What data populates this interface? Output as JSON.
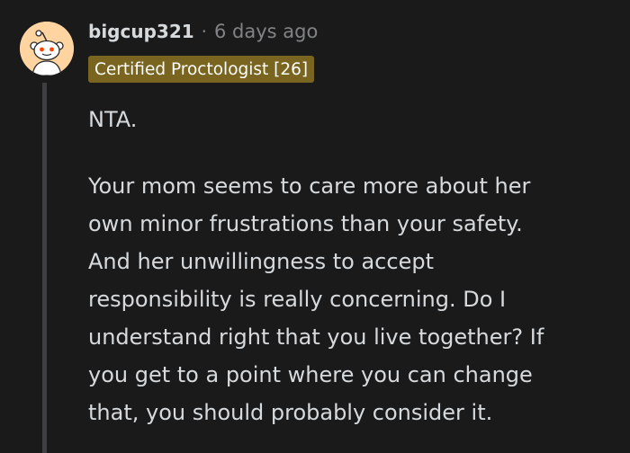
{
  "comment": {
    "username": "bigcup321",
    "separator": "·",
    "timestamp": "6 days ago",
    "flair": "Certified Proctologist [26]",
    "avatar_icon": "reddit-snoo-avatar-icon",
    "paragraphs": [
      [
        "NTA."
      ],
      [
        "Your mom seems to care more about her",
        "own minor frustrations than your safety.",
        "And her unwillingness to accept",
        "responsibility is really concerning. Do I",
        "understand right that you live together? If",
        "you get to a point where you can change",
        "that, you should probably consider it."
      ]
    ]
  },
  "colors": {
    "background": "#1a1a1b",
    "text": "#d7dadc",
    "muted": "#818384",
    "flair_bg": "#7a6520",
    "avatar_bg": "#ffd4a0",
    "thread_line": "#3f3f41"
  }
}
